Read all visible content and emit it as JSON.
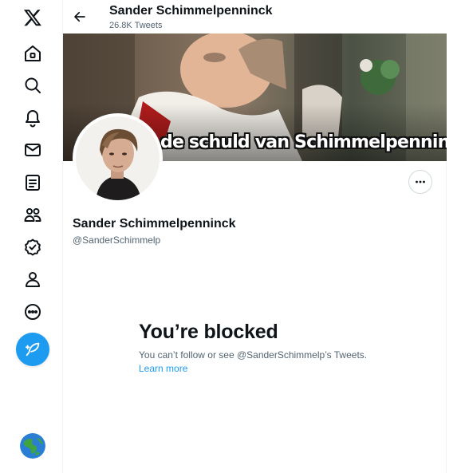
{
  "nav": {
    "items": [
      {
        "name": "x-logo-icon"
      },
      {
        "name": "home-icon"
      },
      {
        "name": "search-icon"
      },
      {
        "name": "notifications-icon"
      },
      {
        "name": "messages-icon"
      },
      {
        "name": "lists-icon"
      },
      {
        "name": "communities-icon"
      },
      {
        "name": "verified-icon"
      },
      {
        "name": "profile-icon"
      },
      {
        "name": "more-icon"
      }
    ],
    "compose_icon": "compose-feather-icon"
  },
  "header": {
    "name": "Sander Schimmelpenninck",
    "tweet_count": "26.8K Tweets"
  },
  "banner": {
    "caption": "de schuld van Schimmelpenninck"
  },
  "profile": {
    "display_name": "Sander Schimmelpenninck",
    "handle": "@SanderSchimmelp"
  },
  "blocked": {
    "title": "You’re blocked",
    "description": "You can’t follow or see @SanderSchimmelp’s Tweets.",
    "learn_more": "Learn more"
  },
  "colors": {
    "accent": "#1d9bf0",
    "text": "#0f1419",
    "secondary_text": "#536471",
    "border": "#eff3f4"
  }
}
